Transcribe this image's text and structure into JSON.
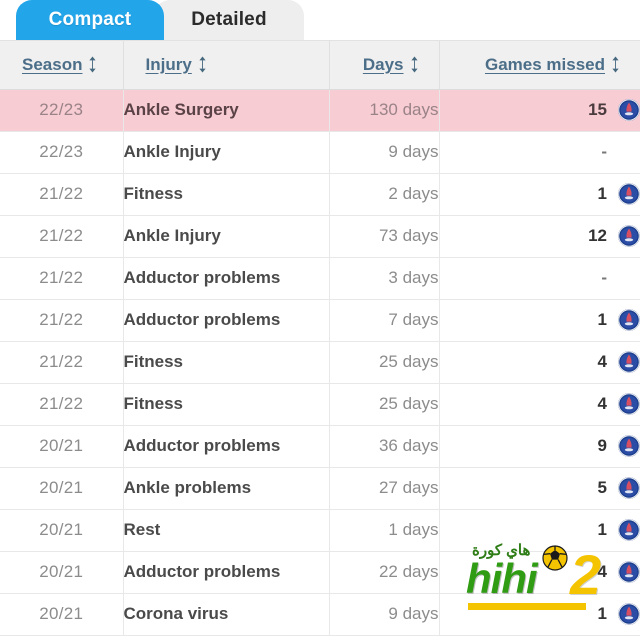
{
  "tabs": [
    {
      "label": "Compact",
      "active": true
    },
    {
      "label": "Detailed",
      "active": false
    }
  ],
  "table": {
    "columns": [
      {
        "key": "season",
        "label": "Season",
        "align": "left",
        "sortable": true
      },
      {
        "key": "injury",
        "label": "Injury",
        "align": "left",
        "sortable": true
      },
      {
        "key": "days",
        "label": "Days",
        "align": "right",
        "sortable": true
      },
      {
        "key": "games_missed",
        "label": "Games missed",
        "align": "right",
        "sortable": true
      }
    ],
    "rows": [
      {
        "season": "22/23",
        "injury": "Ankle Surgery",
        "days": "130 days",
        "games_missed": "15",
        "club_badge": true,
        "highlight": true
      },
      {
        "season": "22/23",
        "injury": "Ankle Injury",
        "days": "9 days",
        "games_missed": "-",
        "club_badge": false,
        "highlight": false
      },
      {
        "season": "21/22",
        "injury": "Fitness",
        "days": "2 days",
        "games_missed": "1",
        "club_badge": true,
        "highlight": false
      },
      {
        "season": "21/22",
        "injury": "Ankle Injury",
        "days": "73 days",
        "games_missed": "12",
        "club_badge": true,
        "highlight": false
      },
      {
        "season": "21/22",
        "injury": "Adductor problems",
        "days": "3 days",
        "games_missed": "-",
        "club_badge": false,
        "highlight": false
      },
      {
        "season": "21/22",
        "injury": "Adductor problems",
        "days": "7 days",
        "games_missed": "1",
        "club_badge": true,
        "highlight": false
      },
      {
        "season": "21/22",
        "injury": "Fitness",
        "days": "25 days",
        "games_missed": "4",
        "club_badge": true,
        "highlight": false
      },
      {
        "season": "21/22",
        "injury": "Fitness",
        "days": "25 days",
        "games_missed": "4",
        "club_badge": true,
        "highlight": false
      },
      {
        "season": "20/21",
        "injury": "Adductor problems",
        "days": "36 days",
        "games_missed": "9",
        "club_badge": true,
        "highlight": false
      },
      {
        "season": "20/21",
        "injury": "Ankle problems",
        "days": "27 days",
        "games_missed": "5",
        "club_badge": true,
        "highlight": false
      },
      {
        "season": "20/21",
        "injury": "Rest",
        "days": "1 days",
        "games_missed": "1",
        "club_badge": true,
        "highlight": false
      },
      {
        "season": "20/21",
        "injury": "Adductor problems",
        "days": "22 days",
        "games_missed": "4",
        "club_badge": true,
        "highlight": false
      },
      {
        "season": "20/21",
        "injury": "Corona virus",
        "days": "9 days",
        "games_missed": "1",
        "club_badge": true,
        "highlight": false
      }
    ]
  },
  "watermark": {
    "arabic_text": "هاي كورة",
    "brand_text": "hihi",
    "brand_suffix": "2"
  },
  "colors": {
    "tab_active_bg": "#23a5ea",
    "tab_inactive_bg": "#eeeeee",
    "header_bg": "#f0f0f0",
    "header_text": "#4c6e88",
    "highlight_row_bg": "#f7ccd3",
    "badge_blue": "#1d3f8f",
    "watermark_green": "#2f9c14",
    "watermark_yellow": "#f5c400"
  },
  "icons": {
    "sort": "sort-updown-icon",
    "club_badge": "psg-club-badge-icon",
    "ball": "soccer-ball-icon"
  }
}
